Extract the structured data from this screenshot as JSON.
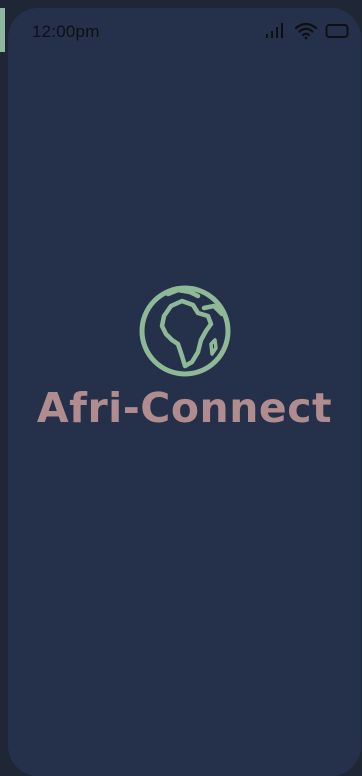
{
  "status_bar": {
    "time": "12:00pm",
    "icons": [
      "signal-icon",
      "wifi-icon",
      "battery-icon"
    ]
  },
  "splash": {
    "logo_icon": "globe-africa-icon",
    "app_name": "Afri-Connect"
  },
  "colors": {
    "background": "#25304a",
    "logo": "#8fb897",
    "app_name": "#b08c8f"
  }
}
